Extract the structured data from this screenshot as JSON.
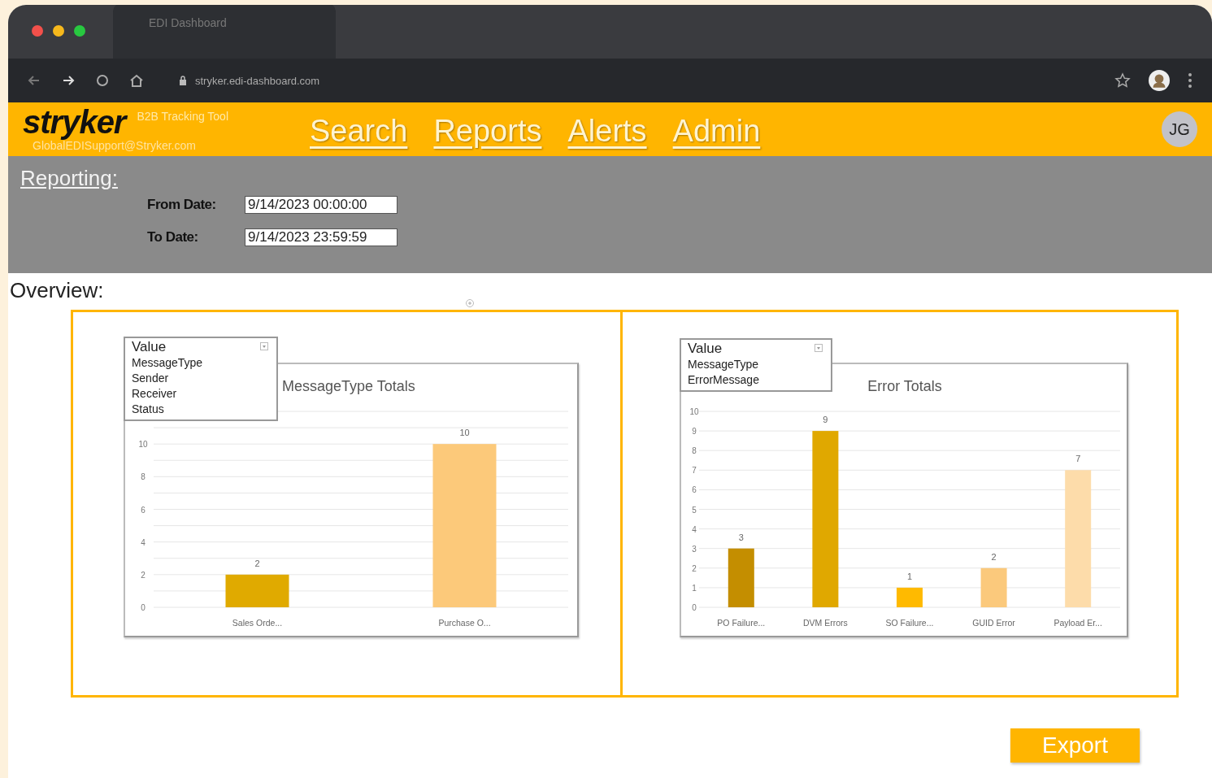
{
  "browser": {
    "tab": {
      "title": "EDI Dashboard",
      "selected": true
    },
    "url": "stryker.edi-dashboard.com"
  },
  "header": {
    "logo": "stryker",
    "subtitle": "B2B Tracking Tool",
    "email": "GlobalEDISupport@Stryker.com",
    "nav": [
      {
        "label": "Search"
      },
      {
        "label": "Reports"
      },
      {
        "label": "Alerts"
      },
      {
        "label": "Admin"
      }
    ],
    "avatar": "JG"
  },
  "reporting": {
    "title": "Reporting:",
    "fields": [
      {
        "label": "From Date:",
        "value": "9/14/2023 00:00:00"
      },
      {
        "label": "To Date:",
        "value": "9/14/2023 23:59:59"
      }
    ]
  },
  "overview": {
    "title": "Overview:",
    "charts": [
      {
        "field_list": {
          "title": "Value",
          "fields": [
            "MessageType",
            "Sender",
            "Receiver",
            "Status"
          ]
        },
        "chart_data": {
          "type": "bar",
          "title": "MessageType Totals",
          "categories": [
            "Sales Orde...",
            "Purchase O..."
          ],
          "values": [
            2,
            10
          ],
          "colors": [
            "#e0aa00",
            "#fcc97a"
          ],
          "grid": true,
          "ylim": [
            0,
            12
          ],
          "yticks": [
            0,
            2,
            4,
            6,
            8,
            10
          ],
          "data_labels": true
        }
      },
      {
        "field_list": {
          "title": "Value",
          "fields": [
            "MessageType",
            "ErrorMessage"
          ]
        },
        "chart_data": {
          "type": "bar",
          "title": "Error Totals",
          "categories": [
            "PO Failure...",
            "DVM Errors",
            "SO Failure...",
            "GUID Error",
            "Payload Er..."
          ],
          "values": [
            3,
            9,
            1,
            2,
            7
          ],
          "colors": [
            "#c48e00",
            "#e0a800",
            "#ffba00",
            "#fbc97c",
            "#fddcaa"
          ],
          "grid": true,
          "ylim": [
            0,
            10
          ],
          "yticks": [
            0,
            1,
            2,
            3,
            4,
            5,
            6,
            7,
            8,
            9,
            10
          ],
          "data_labels": true
        }
      }
    ]
  },
  "export_button": "Export"
}
